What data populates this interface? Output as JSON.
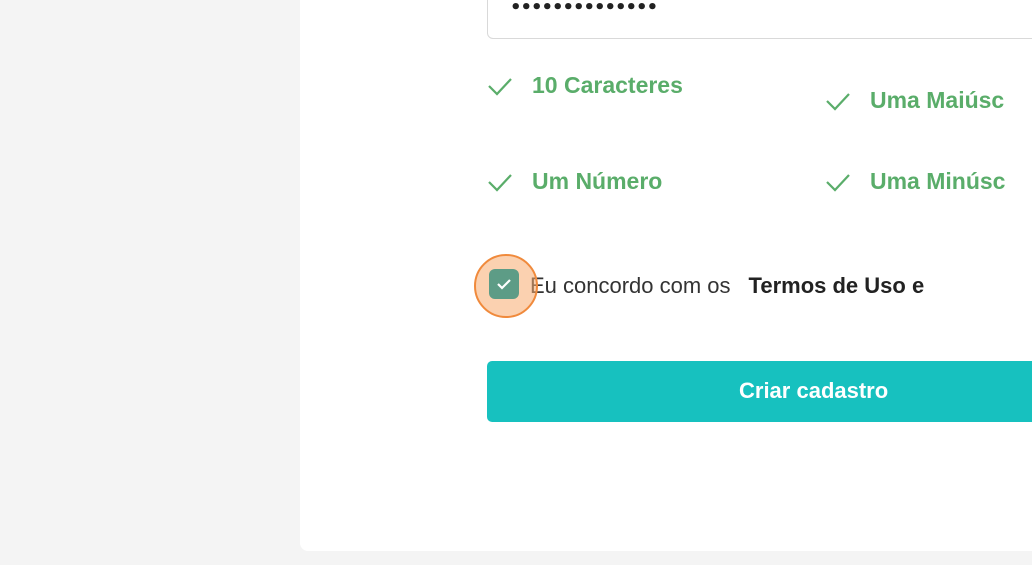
{
  "password": {
    "masked_value": "••••••••••••••"
  },
  "requirements": [
    {
      "label": "10 Caracteres",
      "met": true
    },
    {
      "label": "Uma Maiúsc",
      "met": true
    },
    {
      "label": "Um Número",
      "met": true
    },
    {
      "label": "Uma Minúsc",
      "met": true
    }
  ],
  "terms": {
    "checked": true,
    "text": "Eu concordo com os",
    "link_text": "Termos de Uso e"
  },
  "submit": {
    "label": "Criar cadastro"
  },
  "colors": {
    "success": "#5aad6a",
    "primary": "#17c1bf",
    "checkbox": "#5d9c86",
    "focus_ring": "#f08a3c"
  }
}
